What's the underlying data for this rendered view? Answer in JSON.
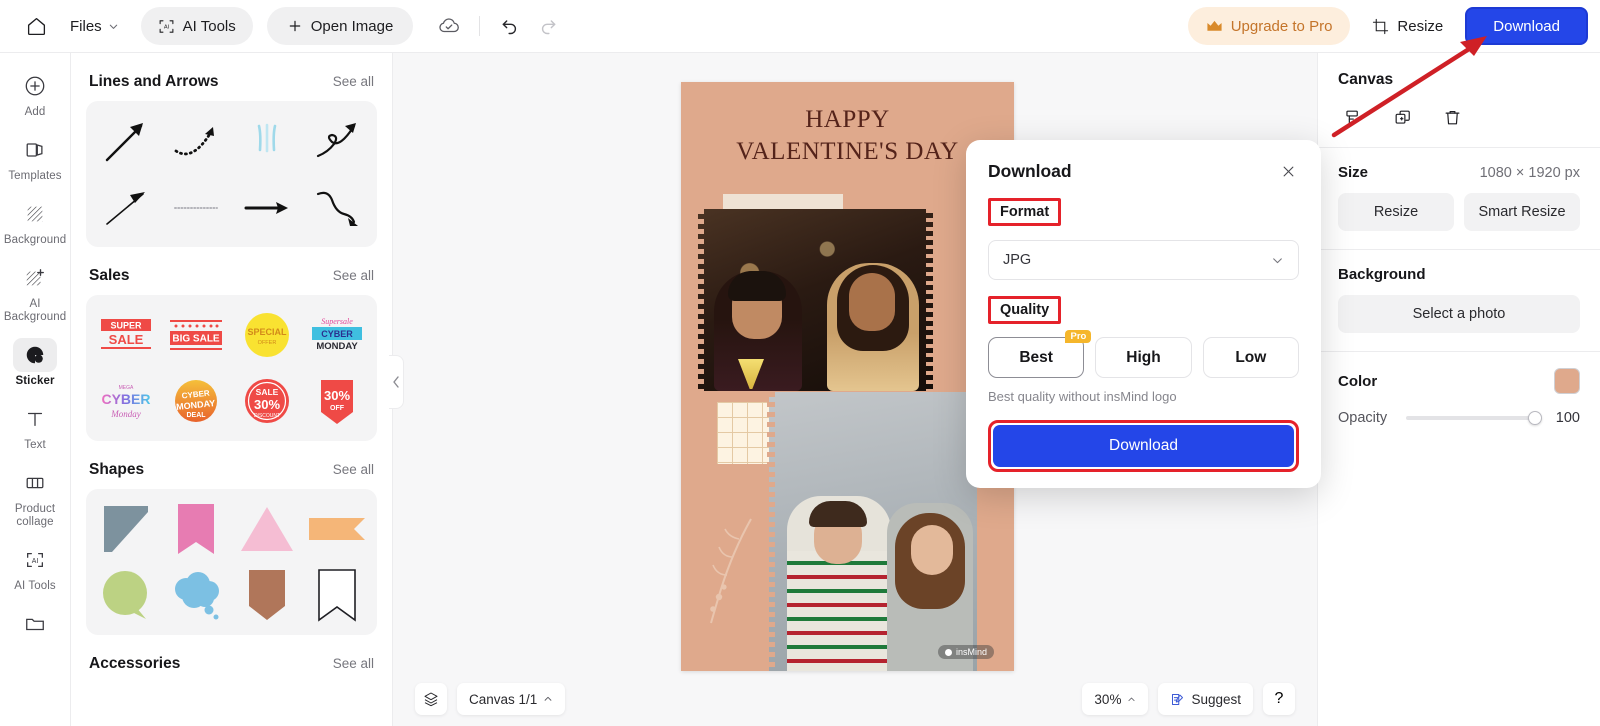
{
  "topbar": {
    "home_icon": "home-icon",
    "files_label": "Files",
    "files_caret": "chevron-down-icon",
    "ai_tools_label": "AI Tools",
    "open_image_label": "Open Image",
    "cloud_icon": "cloud-saved-icon",
    "undo_icon": "undo-icon",
    "redo_icon": "redo-icon",
    "upgrade_label": "Upgrade to Pro",
    "crown_icon": "crown-icon",
    "resize_label": "Resize",
    "resize_icon": "crop-icon",
    "download_label": "Download",
    "download_accent": "#2446e8",
    "upgrade_accent": "#c4742a"
  },
  "rail": {
    "items": [
      {
        "label": "Add",
        "icon": "plus-circle-icon",
        "active": false
      },
      {
        "label": "Templates",
        "icon": "templates-icon",
        "active": false
      },
      {
        "label": "Background",
        "icon": "background-icon",
        "active": false
      },
      {
        "label": "AI Background",
        "icon": "ai-background-icon",
        "active": false
      },
      {
        "label": "Sticker",
        "icon": "sticker-icon",
        "active": true
      },
      {
        "label": "Text",
        "icon": "text-icon",
        "active": false
      },
      {
        "label": "Product collage",
        "icon": "collage-icon",
        "active": false
      },
      {
        "label": "AI Tools",
        "icon": "ai-tools-icon",
        "active": false
      },
      {
        "label": "",
        "icon": "folder-icon",
        "active": false
      }
    ]
  },
  "panel": {
    "see_all_label": "See all",
    "collapse_icon": "chevron-left-icon",
    "sections": [
      {
        "title": "Lines and Arrows",
        "items": [
          "straight-arrow-up-right",
          "dotted-curve-arrow",
          "blue-sparkle-lines",
          "loop-arrow-up",
          "thin-arrow-up-right",
          "dotted-line",
          "bold-right-arrow",
          "wavy-arrow-down"
        ]
      },
      {
        "title": "Sales",
        "items": [
          "SUPER SALE",
          "BIG SALE",
          "SPECIAL OFFER",
          "CYBER MONDAY",
          "CYBER MONDAY GRADIENT",
          "CYBER MONDAY DEAL",
          "SALE 30% DISCOUNT",
          "30% OFF"
        ]
      },
      {
        "title": "Shapes",
        "items": [
          "corner-triangle-gray",
          "ribbon-pink",
          "triangle-pink",
          "flag-orange",
          "speech-bubble-green",
          "thought-cloud-blue",
          "pentagon-brown",
          "bookmark-outline"
        ]
      },
      {
        "title": "Accessories",
        "items": []
      }
    ]
  },
  "canvas": {
    "artwork_title_line1": "HAPPY",
    "artwork_title_line2": "VALENTINE'S DAY",
    "watermark": "insMind",
    "background_color": "#dfa98c"
  },
  "bottombar": {
    "layers_icon": "layers-icon",
    "canvas_label": "Canvas 1/1",
    "canvas_caret": "chevron-up-icon",
    "zoom_label": "30%",
    "zoom_caret": "chevron-up-icon",
    "suggest_label": "Suggest",
    "suggest_icon": "suggest-icon",
    "help_label": "?"
  },
  "right_panel": {
    "title": "Canvas",
    "tool_icons": [
      "color-picker-icon",
      "duplicate-icon",
      "trash-icon"
    ],
    "size_label": "Size",
    "size_value": "1080 × 1920 px",
    "resize_label": "Resize",
    "smart_resize_label": "Smart Resize",
    "background_label": "Background",
    "select_photo_label": "Select a photo",
    "color_label": "Color",
    "color_value": "#dfa98c",
    "opacity_label": "Opacity",
    "opacity_value": "100"
  },
  "dialog": {
    "title": "Download",
    "close_icon": "close-icon",
    "format_label": "Format",
    "format_value": "JPG",
    "format_caret": "chevron-down-icon",
    "quality_label": "Quality",
    "quality_options": [
      {
        "label": "Best",
        "badge": "Pro",
        "selected": true
      },
      {
        "label": "High",
        "badge": "",
        "selected": false
      },
      {
        "label": "Low",
        "badge": "",
        "selected": false
      }
    ],
    "quality_hint": "Best quality without insMind logo",
    "download_label": "Download",
    "highlight_color": "#e5222a"
  }
}
